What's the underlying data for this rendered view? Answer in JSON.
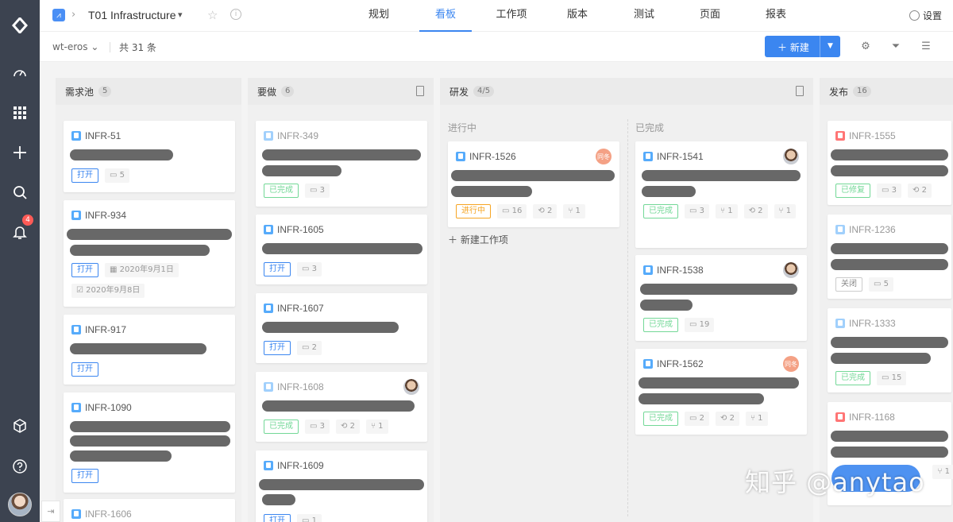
{
  "header": {
    "project_name": "T01 Infrastructure",
    "tabs": [
      "规划",
      "看板",
      "工作项",
      "版本",
      "测试",
      "页面",
      "报表"
    ],
    "active_tab": "看板",
    "settings_label": "设置"
  },
  "sidebar": {
    "notification_count": "4"
  },
  "toolbar": {
    "scope": "wt-eros",
    "count": "共 31 条",
    "new_label": "新建"
  },
  "columns": {
    "backlog": {
      "title": "需求池",
      "count": "5"
    },
    "todo": {
      "title": "要做",
      "count": "6"
    },
    "dev": {
      "title": "研发",
      "count": "4/5",
      "in_progress": "进行中",
      "done": "已完成",
      "new_item": "新建工作项"
    },
    "release": {
      "title": "发布",
      "count": "16"
    }
  },
  "cards": {
    "c51": {
      "id": "INFR-51",
      "status": "打开",
      "comments": "5"
    },
    "c934": {
      "id": "INFR-934",
      "status": "打开",
      "start": "2020年9月1日",
      "due": "2020年9月8日"
    },
    "c917": {
      "id": "INFR-917",
      "status": "打开"
    },
    "c1090": {
      "id": "INFR-1090",
      "status": "打开"
    },
    "c1606": {
      "id": "INFR-1606"
    },
    "c349": {
      "id": "INFR-349",
      "status": "已完成",
      "comments": "3"
    },
    "c1605": {
      "id": "INFR-1605",
      "status": "打开",
      "comments": "3"
    },
    "c1607": {
      "id": "INFR-1607",
      "status": "打开",
      "comments": "2"
    },
    "c1608": {
      "id": "INFR-1608",
      "status": "已完成",
      "comments": "3",
      "links": "2",
      "prs": "1"
    },
    "c1609": {
      "id": "INFR-1609",
      "status": "打开",
      "comments": "1"
    },
    "c1526": {
      "id": "INFR-1526",
      "status": "进行中",
      "comments": "16",
      "links": "2",
      "prs": "1",
      "avatar": "同冬"
    },
    "c1541": {
      "id": "INFR-1541",
      "status": "已完成",
      "comments": "3",
      "prs": "1",
      "links": "2",
      "prs2": "1"
    },
    "c1538": {
      "id": "INFR-1538",
      "status": "已完成",
      "comments": "19"
    },
    "c1562": {
      "id": "INFR-1562",
      "status": "已完成",
      "comments": "2",
      "links": "2",
      "prs": "1",
      "avatar": "同冬"
    },
    "c1555": {
      "id": "INFR-1555",
      "status": "已修复",
      "comments": "3",
      "links": "2"
    },
    "c1236": {
      "id": "INFR-1236",
      "status": "关闭",
      "comments": "5"
    },
    "c1333": {
      "id": "INFR-1333",
      "status": "已完成",
      "comments": "15"
    },
    "c1168": {
      "id": "INFR-1168",
      "prs": "1"
    }
  },
  "watermark": "知乎 @anytao"
}
